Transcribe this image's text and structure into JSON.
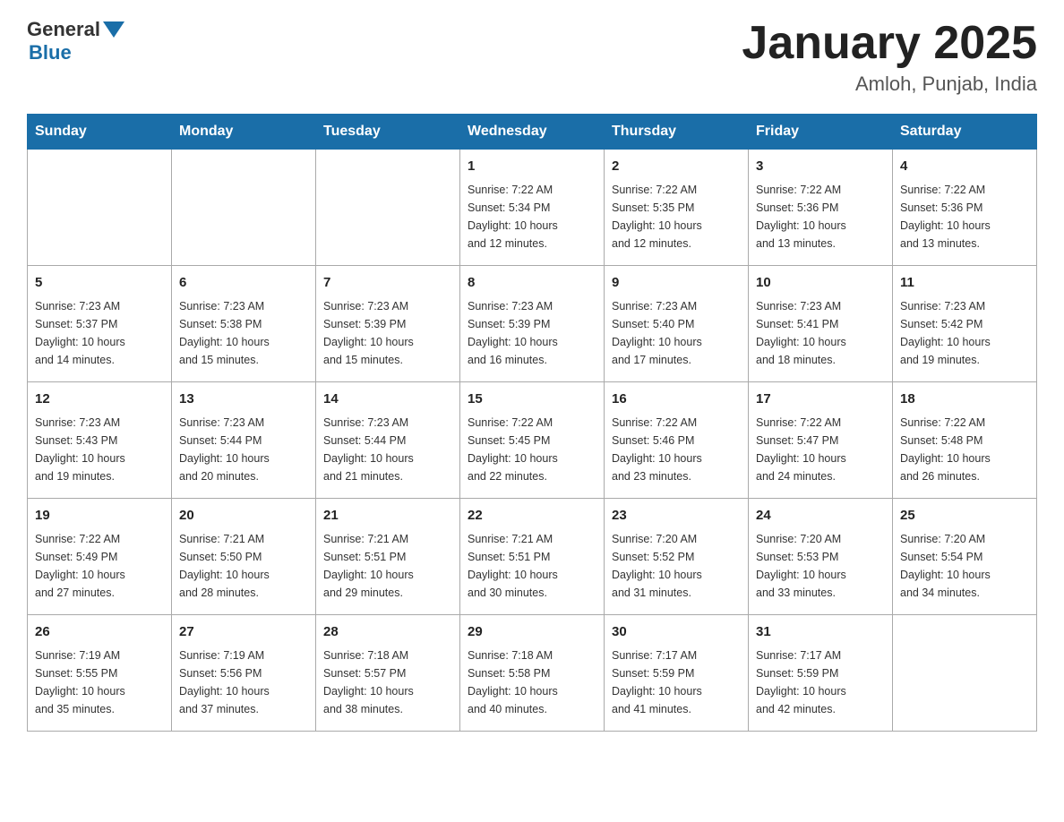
{
  "header": {
    "logo_general": "General",
    "logo_blue": "Blue",
    "title": "January 2025",
    "subtitle": "Amloh, Punjab, India"
  },
  "weekdays": [
    "Sunday",
    "Monday",
    "Tuesday",
    "Wednesday",
    "Thursday",
    "Friday",
    "Saturday"
  ],
  "weeks": [
    [
      {
        "day": "",
        "info": ""
      },
      {
        "day": "",
        "info": ""
      },
      {
        "day": "",
        "info": ""
      },
      {
        "day": "1",
        "info": "Sunrise: 7:22 AM\nSunset: 5:34 PM\nDaylight: 10 hours\nand 12 minutes."
      },
      {
        "day": "2",
        "info": "Sunrise: 7:22 AM\nSunset: 5:35 PM\nDaylight: 10 hours\nand 12 minutes."
      },
      {
        "day": "3",
        "info": "Sunrise: 7:22 AM\nSunset: 5:36 PM\nDaylight: 10 hours\nand 13 minutes."
      },
      {
        "day": "4",
        "info": "Sunrise: 7:22 AM\nSunset: 5:36 PM\nDaylight: 10 hours\nand 13 minutes."
      }
    ],
    [
      {
        "day": "5",
        "info": "Sunrise: 7:23 AM\nSunset: 5:37 PM\nDaylight: 10 hours\nand 14 minutes."
      },
      {
        "day": "6",
        "info": "Sunrise: 7:23 AM\nSunset: 5:38 PM\nDaylight: 10 hours\nand 15 minutes."
      },
      {
        "day": "7",
        "info": "Sunrise: 7:23 AM\nSunset: 5:39 PM\nDaylight: 10 hours\nand 15 minutes."
      },
      {
        "day": "8",
        "info": "Sunrise: 7:23 AM\nSunset: 5:39 PM\nDaylight: 10 hours\nand 16 minutes."
      },
      {
        "day": "9",
        "info": "Sunrise: 7:23 AM\nSunset: 5:40 PM\nDaylight: 10 hours\nand 17 minutes."
      },
      {
        "day": "10",
        "info": "Sunrise: 7:23 AM\nSunset: 5:41 PM\nDaylight: 10 hours\nand 18 minutes."
      },
      {
        "day": "11",
        "info": "Sunrise: 7:23 AM\nSunset: 5:42 PM\nDaylight: 10 hours\nand 19 minutes."
      }
    ],
    [
      {
        "day": "12",
        "info": "Sunrise: 7:23 AM\nSunset: 5:43 PM\nDaylight: 10 hours\nand 19 minutes."
      },
      {
        "day": "13",
        "info": "Sunrise: 7:23 AM\nSunset: 5:44 PM\nDaylight: 10 hours\nand 20 minutes."
      },
      {
        "day": "14",
        "info": "Sunrise: 7:23 AM\nSunset: 5:44 PM\nDaylight: 10 hours\nand 21 minutes."
      },
      {
        "day": "15",
        "info": "Sunrise: 7:22 AM\nSunset: 5:45 PM\nDaylight: 10 hours\nand 22 minutes."
      },
      {
        "day": "16",
        "info": "Sunrise: 7:22 AM\nSunset: 5:46 PM\nDaylight: 10 hours\nand 23 minutes."
      },
      {
        "day": "17",
        "info": "Sunrise: 7:22 AM\nSunset: 5:47 PM\nDaylight: 10 hours\nand 24 minutes."
      },
      {
        "day": "18",
        "info": "Sunrise: 7:22 AM\nSunset: 5:48 PM\nDaylight: 10 hours\nand 26 minutes."
      }
    ],
    [
      {
        "day": "19",
        "info": "Sunrise: 7:22 AM\nSunset: 5:49 PM\nDaylight: 10 hours\nand 27 minutes."
      },
      {
        "day": "20",
        "info": "Sunrise: 7:21 AM\nSunset: 5:50 PM\nDaylight: 10 hours\nand 28 minutes."
      },
      {
        "day": "21",
        "info": "Sunrise: 7:21 AM\nSunset: 5:51 PM\nDaylight: 10 hours\nand 29 minutes."
      },
      {
        "day": "22",
        "info": "Sunrise: 7:21 AM\nSunset: 5:51 PM\nDaylight: 10 hours\nand 30 minutes."
      },
      {
        "day": "23",
        "info": "Sunrise: 7:20 AM\nSunset: 5:52 PM\nDaylight: 10 hours\nand 31 minutes."
      },
      {
        "day": "24",
        "info": "Sunrise: 7:20 AM\nSunset: 5:53 PM\nDaylight: 10 hours\nand 33 minutes."
      },
      {
        "day": "25",
        "info": "Sunrise: 7:20 AM\nSunset: 5:54 PM\nDaylight: 10 hours\nand 34 minutes."
      }
    ],
    [
      {
        "day": "26",
        "info": "Sunrise: 7:19 AM\nSunset: 5:55 PM\nDaylight: 10 hours\nand 35 minutes."
      },
      {
        "day": "27",
        "info": "Sunrise: 7:19 AM\nSunset: 5:56 PM\nDaylight: 10 hours\nand 37 minutes."
      },
      {
        "day": "28",
        "info": "Sunrise: 7:18 AM\nSunset: 5:57 PM\nDaylight: 10 hours\nand 38 minutes."
      },
      {
        "day": "29",
        "info": "Sunrise: 7:18 AM\nSunset: 5:58 PM\nDaylight: 10 hours\nand 40 minutes."
      },
      {
        "day": "30",
        "info": "Sunrise: 7:17 AM\nSunset: 5:59 PM\nDaylight: 10 hours\nand 41 minutes."
      },
      {
        "day": "31",
        "info": "Sunrise: 7:17 AM\nSunset: 5:59 PM\nDaylight: 10 hours\nand 42 minutes."
      },
      {
        "day": "",
        "info": ""
      }
    ]
  ]
}
